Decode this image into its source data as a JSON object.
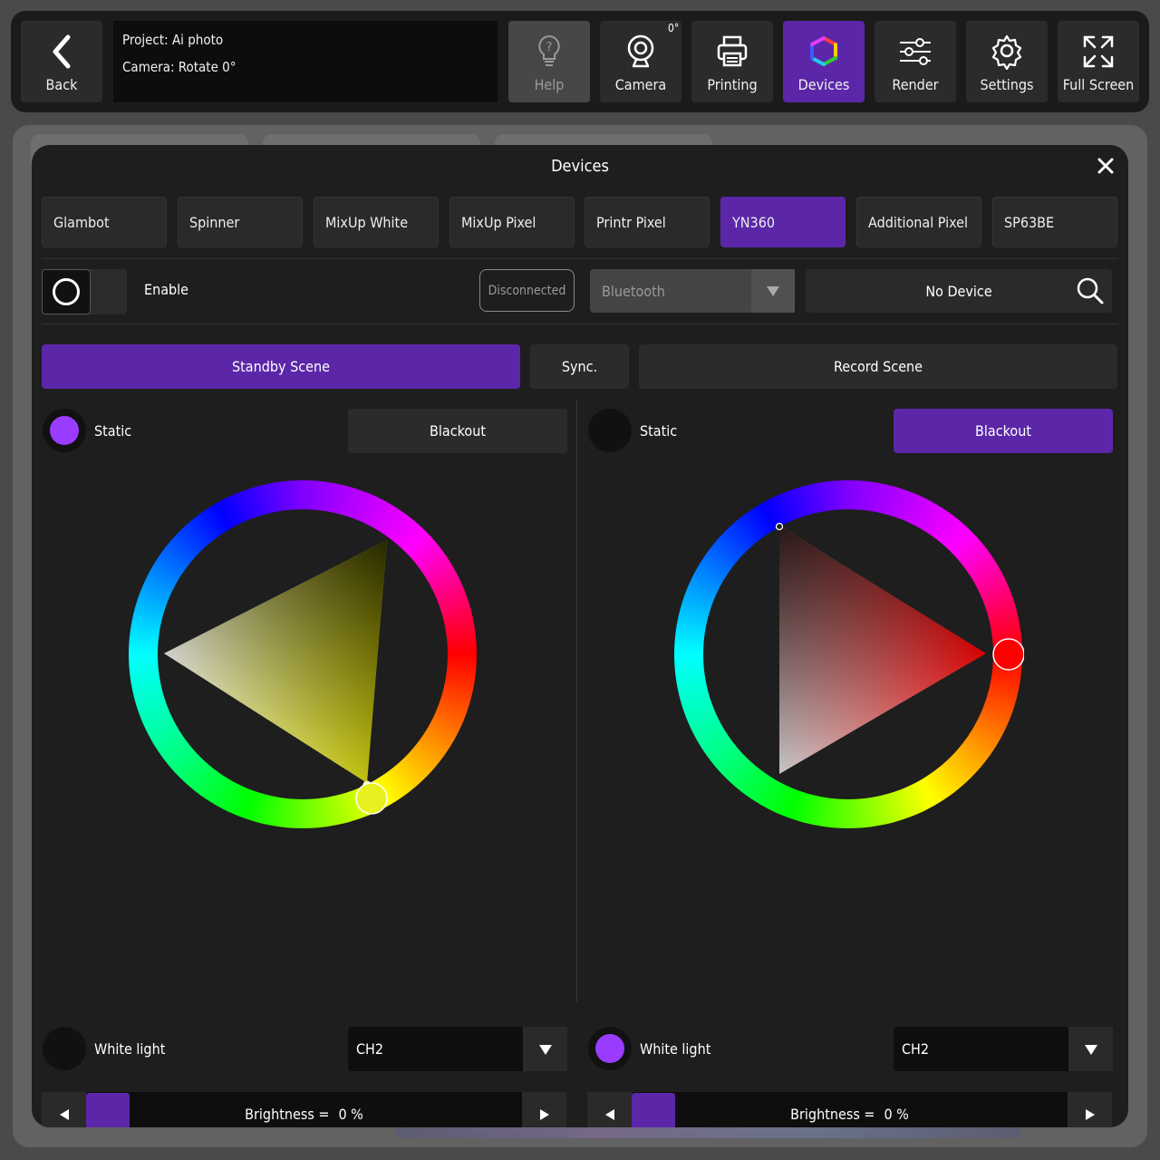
{
  "toolbar": {
    "back_label": "Back",
    "project_line": "Project: Ai photo",
    "camera_line": "Camera: Rotate 0°",
    "help_label": "Help",
    "camera_label": "Camera",
    "camera_rotation": "0°",
    "printing_label": "Printing",
    "devices_label": "Devices",
    "render_label": "Render",
    "settings_label": "Settings",
    "fullscreen_label": "Full Screen"
  },
  "modal": {
    "title": "Devices",
    "device_tabs": [
      "Glambot",
      "Spinner",
      "MixUp White",
      "MixUp Pixel",
      "Printr Pixel",
      "YN360",
      "Additional Pixel",
      "SP63BE"
    ],
    "active_tab": "YN360",
    "enable_label": "Enable",
    "connection_status": "Disconnected",
    "connection_type": "Bluetooth",
    "device_name": "No Device",
    "scene_tabs": {
      "standby": "Standby Scene",
      "sync": "Sync.",
      "record": "Record Scene"
    }
  },
  "standby": {
    "static_label": "Static",
    "static_color": "#9a3cff",
    "blackout_label": "Blackout",
    "blackout_active": false,
    "hue_color": "#ffff00",
    "white_label": "White light",
    "white_active": false,
    "channel": "CH2",
    "brightness_label": "Brightness =",
    "brightness_value": "0 %"
  },
  "record": {
    "static_label": "Static",
    "static_active": false,
    "blackout_label": "Blackout",
    "blackout_active": true,
    "hue_color": "#ff0000",
    "white_label": "White light",
    "white_color": "#9a3cff",
    "channel": "CH2",
    "brightness_label": "Brightness =",
    "brightness_value": "0 %"
  },
  "colors": {
    "accent": "#5b27a8",
    "panel_bg": "#1e1e1e",
    "button_bg": "#2b2b2b"
  }
}
